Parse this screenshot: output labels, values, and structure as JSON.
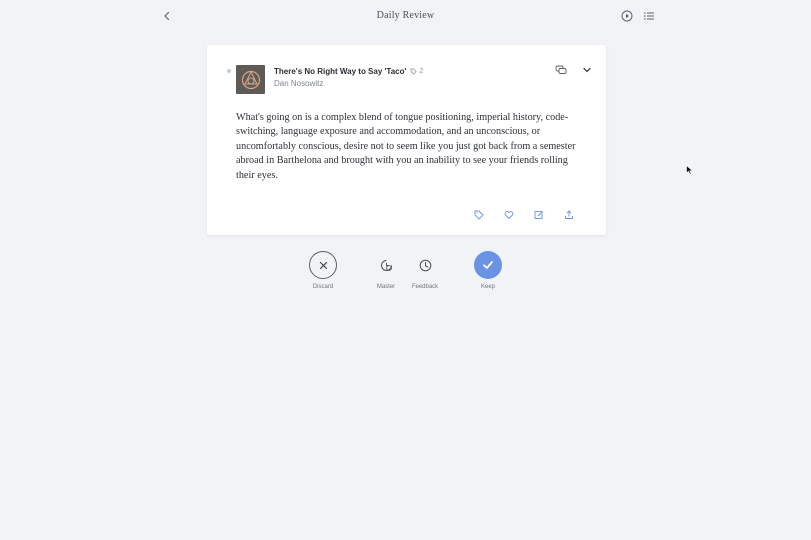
{
  "header": {
    "title": "Daily Review",
    "back_icon": "chevron-left-icon",
    "play_icon": "play-circle-icon",
    "list_icon": "list-icon"
  },
  "card": {
    "thumbnail_icon": "book-cover-logo",
    "title": "There's No Right Way to Say 'Taco'",
    "tag_count": "2",
    "author": "Dan Nosowitz",
    "body": "What's going on is a complex blend of tongue positioning, imperial history, code-switching, language exposure and accommodation, and an unconscious, or uncomfortably conscious, desire not to seem like you just got back from a semester abroad in Barthelona and brought with you an inability to see your friends rolling their eyes.",
    "actions": [
      "tag-icon",
      "heart-icon",
      "edit-icon",
      "share-icon"
    ]
  },
  "review_actions": {
    "discard": "Discard",
    "master": "Master",
    "feedback": "Feedback",
    "keep": "Keep"
  },
  "colors": {
    "background": "#f1f3f6",
    "keep_accent": "#6a93e3",
    "card_bg": "#ffffff"
  }
}
